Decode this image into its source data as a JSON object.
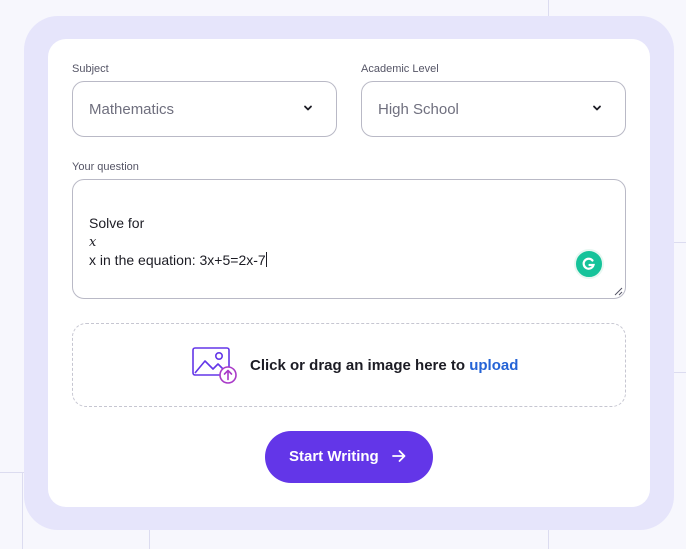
{
  "form": {
    "subject_label": "Subject",
    "subject_value": "Mathematics",
    "level_label": "Academic Level",
    "level_value": "High School",
    "question_label": "Your question",
    "question_line1": "Solve for",
    "question_math": "x",
    "question_line2": "x in the equation: 3x+5=2x-7",
    "upload_text": "Click or drag an image here to ",
    "upload_link": "upload",
    "submit_label": "Start Writing"
  },
  "icons": {
    "select_chevron": "chevron-down-icon",
    "grammar": "grammarly-icon",
    "upload": "image-upload-icon",
    "submit_arrow": "arrow-right-icon"
  },
  "colors": {
    "accent": "#6336e8",
    "link": "#2463d6",
    "outer_frame": "#e6e5fb",
    "grammar": "#15c39a"
  }
}
